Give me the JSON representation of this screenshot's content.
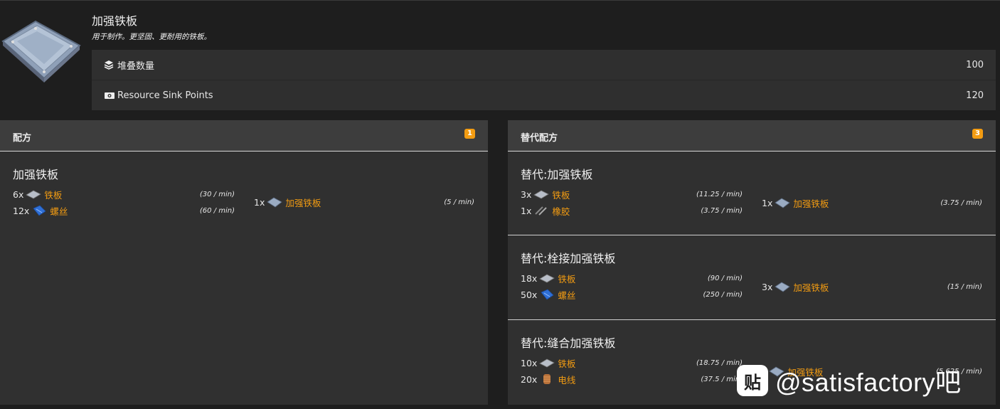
{
  "item": {
    "name": "加强铁板",
    "description": "用于制作。更坚固、更耐用的铁板。",
    "stats": [
      {
        "label": "堆叠数量",
        "value": "100",
        "icon": "stack-icon"
      },
      {
        "label": "Resource Sink Points",
        "value": "120",
        "icon": "ticket-icon"
      }
    ]
  },
  "recipes_panel": {
    "title": "配方",
    "badge": "1",
    "recipes": [
      {
        "name": "加强铁板",
        "inputs": [
          {
            "qty": "6x",
            "name": "铁板",
            "rate": "(30 / min)",
            "icon": "iron-plate-icon"
          },
          {
            "qty": "12x",
            "name": "螺丝",
            "rate": "(60 / min)",
            "icon": "screw-icon"
          }
        ],
        "output": {
          "qty": "1x",
          "name": "加强铁板",
          "rate": "(5 / min)",
          "icon": "reinforced-plate-icon"
        }
      }
    ]
  },
  "alt_panel": {
    "title": "替代配方",
    "badge": "3",
    "recipes": [
      {
        "name": "替代:加强铁板",
        "inputs": [
          {
            "qty": "3x",
            "name": "铁板",
            "rate": "(11.25 / min)",
            "icon": "iron-plate-icon"
          },
          {
            "qty": "1x",
            "name": "橡胶",
            "rate": "(3.75 / min)",
            "icon": "rubber-icon"
          }
        ],
        "output": {
          "qty": "1x",
          "name": "加强铁板",
          "rate": "(3.75 / min)",
          "icon": "reinforced-plate-icon"
        }
      },
      {
        "name": "替代:栓接加强铁板",
        "inputs": [
          {
            "qty": "18x",
            "name": "铁板",
            "rate": "(90 / min)",
            "icon": "iron-plate-icon"
          },
          {
            "qty": "50x",
            "name": "螺丝",
            "rate": "(250 / min)",
            "icon": "screw-icon"
          }
        ],
        "output": {
          "qty": "3x",
          "name": "加强铁板",
          "rate": "(15 / min)",
          "icon": "reinforced-plate-icon"
        }
      },
      {
        "name": "替代:缝合加强铁板",
        "inputs": [
          {
            "qty": "10x",
            "name": "铁板",
            "rate": "(18.75 / min)",
            "icon": "iron-plate-icon"
          },
          {
            "qty": "20x",
            "name": "电线",
            "rate": "(37.5 / min)",
            "icon": "wire-icon"
          }
        ],
        "output": {
          "qty": "x",
          "name": "加强铁板",
          "rate": "(5.625 / min)",
          "icon": "reinforced-plate-icon"
        }
      }
    ]
  },
  "watermark": {
    "logo_text": "贴",
    "text": "@satisfactory吧"
  },
  "colors": {
    "accent": "#f39c12",
    "panel": "#303030",
    "header": "#3d3d3d",
    "background": "#1e1e1e"
  }
}
